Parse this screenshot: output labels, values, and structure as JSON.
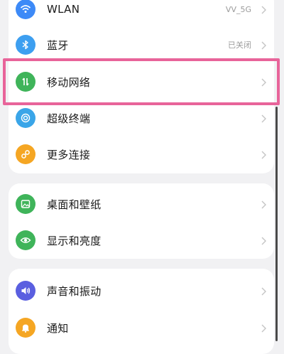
{
  "groups": [
    {
      "rows": [
        {
          "label": "WLAN",
          "value": "VV_5G",
          "icon": "wifi-icon",
          "color": "#3d8af7"
        },
        {
          "label": "蓝牙",
          "value": "已关闭",
          "icon": "bluetooth-icon",
          "color": "#3d9ff0"
        },
        {
          "label": "移动网络",
          "value": "",
          "icon": "mobile-network-icon",
          "color": "#3fb45a"
        },
        {
          "label": "超级终端",
          "value": "",
          "icon": "super-device-icon",
          "color": "#3aa5e8"
        },
        {
          "label": "更多连接",
          "value": "",
          "icon": "more-connections-icon",
          "color": "#f5a623"
        }
      ]
    },
    {
      "rows": [
        {
          "label": "桌面和壁纸",
          "value": "",
          "icon": "wallpaper-icon",
          "color": "#3fb45a"
        },
        {
          "label": "显示和亮度",
          "value": "",
          "icon": "eye-icon",
          "color": "#3fb45a"
        }
      ]
    },
    {
      "rows": [
        {
          "label": "声音和振动",
          "value": "",
          "icon": "speaker-icon",
          "color": "#5a5fe0"
        },
        {
          "label": "通知",
          "value": "",
          "icon": "bell-icon",
          "color": "#f5a623"
        }
      ]
    }
  ]
}
